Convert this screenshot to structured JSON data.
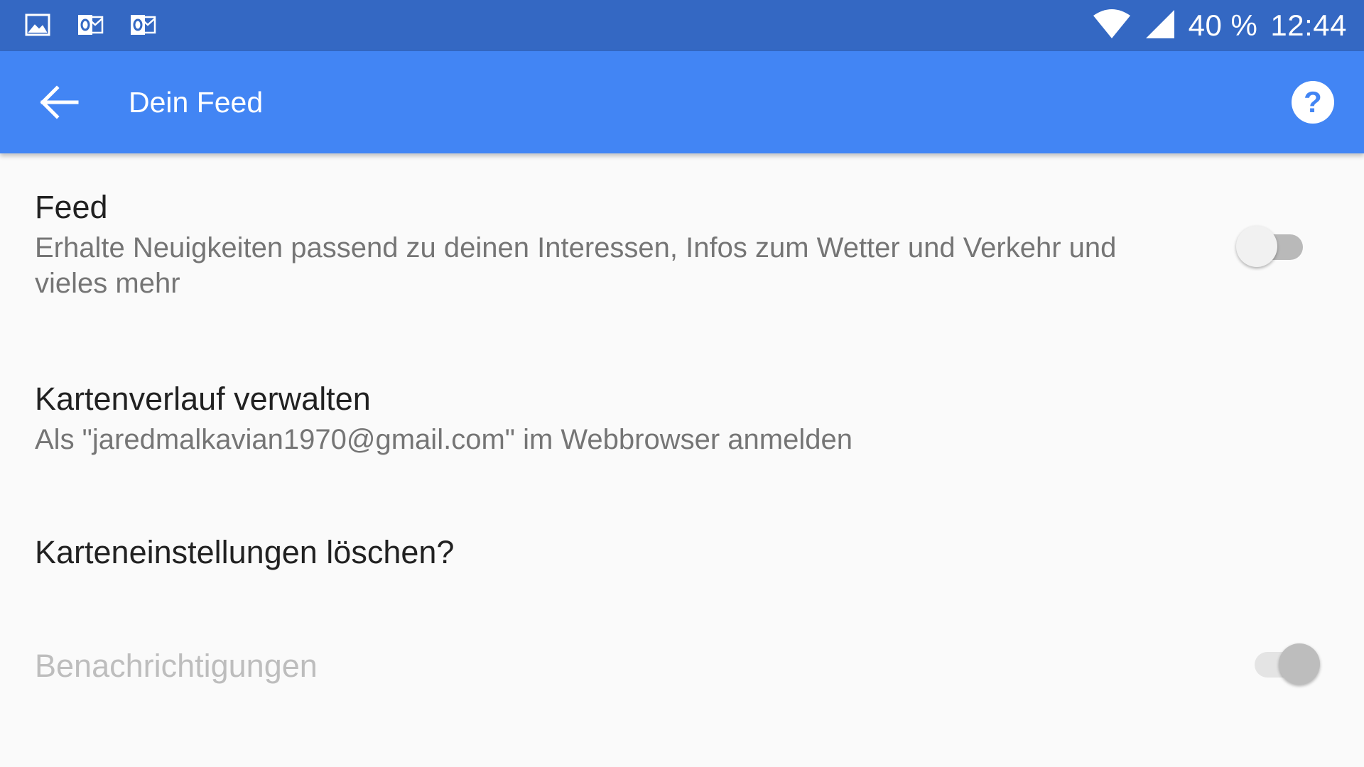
{
  "status_bar": {
    "left_icons": [
      "image-icon",
      "outlook-icon",
      "outlook-icon"
    ],
    "battery": "40 %",
    "time": "12:44"
  },
  "app_bar": {
    "title": "Dein Feed",
    "back_icon": "arrow-left-icon",
    "help_icon": "help-circle-icon"
  },
  "settings": [
    {
      "title": "Feed",
      "summary": "Erhalte Neuigkeiten passend zu deinen Interessen, Infos zum Wetter und Verkehr und vieles mehr",
      "switch": {
        "checked": false,
        "enabled": true
      }
    },
    {
      "title": "Kartenverlauf verwalten",
      "summary": "Als \"jaredmalkavian1970@gmail.com\" im Webbrowser anmelden"
    },
    {
      "title": "Karteneinstellungen löschen?"
    },
    {
      "title": "Benachrichtigungen",
      "switch": {
        "checked": true,
        "enabled": false
      }
    }
  ],
  "colors": {
    "status_bar": "#3468c3",
    "app_bar": "#4285f4",
    "background": "#fafafa",
    "title_text": "#212121",
    "summary_text": "#757575",
    "disabled_text": "#bdbdbd"
  }
}
